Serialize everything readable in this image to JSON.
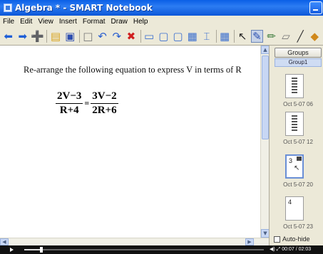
{
  "window": {
    "title": "Algebra * - SMART Notebook"
  },
  "menu": {
    "items": [
      "File",
      "Edit",
      "View",
      "Insert",
      "Format",
      "Draw",
      "Help"
    ]
  },
  "toolbar": {
    "icons": [
      "back-arrow",
      "forward-arrow",
      "add-page",
      "open-folder",
      "save",
      "paste",
      "undo",
      "redo",
      "delete",
      "screen-shade",
      "display",
      "capture",
      "document-camera",
      "table",
      "select-arrow",
      "pen",
      "creative-pen",
      "line",
      "paint"
    ]
  },
  "page": {
    "instruction": "Re-arrange the following equation to express V in terms of R",
    "equation": {
      "left_num": "2V−3",
      "left_den": "R+4",
      "equals": "=",
      "right_num": "3V−2",
      "right_den": "2R+6"
    }
  },
  "side_panel": {
    "groups_button": "Groups",
    "group_tab": "Group1",
    "thumbnails": [
      {
        "number": "",
        "label": "Oct 5-07 06",
        "selected": false
      },
      {
        "number": "",
        "label": "Oct 5-07 12",
        "selected": false
      },
      {
        "number": "3",
        "label": "Oct 5-07 20",
        "selected": true
      },
      {
        "number": "4",
        "label": "Oct 5-07 23",
        "selected": false
      }
    ],
    "autohide_label": "Auto-hide"
  },
  "player": {
    "time": "00:07 / 02:03",
    "progress": 0.07
  }
}
